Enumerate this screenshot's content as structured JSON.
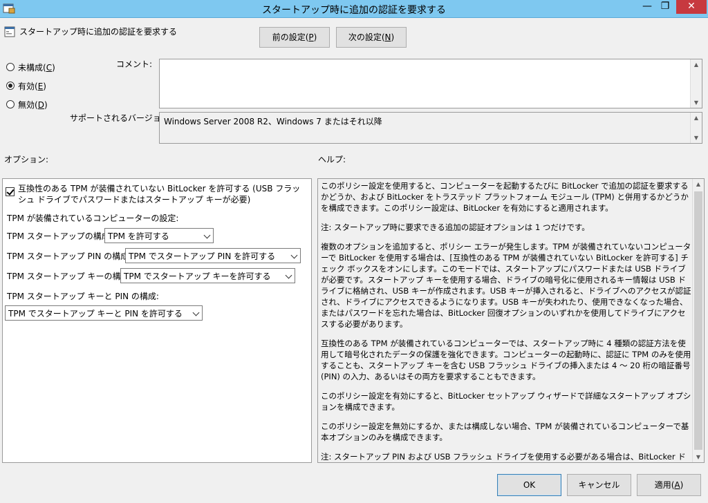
{
  "window": {
    "title": "スタートアップ時に追加の認証を要求する",
    "min_glyph": "—",
    "max_glyph": "❐",
    "close_glyph": "✕"
  },
  "header": {
    "policy_name": "スタートアップ時に追加の認証を要求する",
    "prev_button": {
      "text": "前の設定(",
      "key": "P",
      "suffix": ")"
    },
    "next_button": {
      "text": "次の設定(",
      "key": "N",
      "suffix": ")"
    }
  },
  "state": {
    "options": [
      {
        "text": "未構成(",
        "key": "C",
        "suffix": ")",
        "selected": false
      },
      {
        "text": "有効(",
        "key": "E",
        "suffix": ")",
        "selected": true
      },
      {
        "text": "無効(",
        "key": "D",
        "suffix": ")",
        "selected": false
      }
    ]
  },
  "comment": {
    "label": "コメント:",
    "value": ""
  },
  "supported": {
    "label": "サポートされるバージョン:",
    "value": "Windows Server 2008 R2、Windows 7 またはそれ以降"
  },
  "options_section": {
    "label": "オプション:",
    "allow_checkbox": {
      "checked": true,
      "label": "互換性のある TPM が装備されていない BitLocker を許可する (USB フラッシュ ドライブでパスワードまたはスタートアップ キーが必要)"
    },
    "tpm_group_label": "TPM が装備されているコンピューターの設定:",
    "startup_label": "TPM スタートアップの構成:",
    "startup_value": "TPM を許可する",
    "pin_label": "TPM スタートアップ PIN の構成:",
    "pin_value": "TPM でスタートアップ PIN を許可する",
    "key_label": "TPM スタートアップ キーの構成:",
    "key_value": "TPM でスタートアップ キーを許可する",
    "keypin_label": "TPM スタートアップ キーと PIN の構成:",
    "keypin_value": "TPM でスタートアップ キーと PIN を許可する"
  },
  "help_section": {
    "label": "ヘルプ:",
    "paragraphs": [
      "このポリシー設定を使用すると、コンピューターを起動するたびに BitLocker で追加の認証を要求するかどうか、および BitLocker をトラステッド プラットフォーム モジュール (TPM) と併用するかどうかを構成できます。このポリシー設定は、BitLocker を有効にすると適用されます。",
      "注: スタートアップ時に要求できる追加の認証オプションは 1 つだけです。",
      "複数のオプションを追加すると、ポリシー エラーが発生します。TPM が装備されていないコンピューターで BitLocker を使用する場合は、[互換性のある TPM が装備されていない BitLocker を許可する] チェック ボックスをオンにします。このモードでは、スタートアップにパスワードまたは USB ドライブが必要です。スタートアップ キーを使用する場合、ドライブの暗号化に使用されるキー情報は USB ドライブに格納され、USB キーが作成されます。USB キーが挿入されると、ドライブへのアクセスが認証され、ドライブにアクセスできるようになります。USB キーが失われたり、使用できなくなった場合、またはパスワードを忘れた場合は、BitLocker 回復オプションのいずれかを使用してドライブにアクセスする必要があります。",
      "互換性のある TPM が装備されているコンピューターでは、スタートアップ時に 4 種類の認証方法を使用して暗号化されたデータの保護を強化できます。コンピューターの起動時に、認証に TPM のみを使用することも、スタートアップ キーを含む USB フラッシュ ドライブの挿入または 4 ～ 20 桁の暗証番号 (PIN) の入力、あるいはその両方を要求することもできます。",
      "このポリシー設定を有効にすると、BitLocker セットアップ ウィザードで詳細なスタートアップ オプションを構成できます。",
      "このポリシー設定を無効にするか、または構成しない場合、TPM が装備されているコンピューターで基本オプションのみを構成できます。",
      "注: スタートアップ PIN および USB フラッシュ ドライブを使用する必要がある場合は、BitLocker ドライブ暗号化セットアップ ウィザードではなく、コマンドライン ツール manage-bde を使用して BitLocker 設定を構成する必要"
    ]
  },
  "footer": {
    "ok": "OK",
    "cancel": "キャンセル",
    "apply": {
      "text": "適用(",
      "key": "A",
      "suffix": ")"
    }
  }
}
